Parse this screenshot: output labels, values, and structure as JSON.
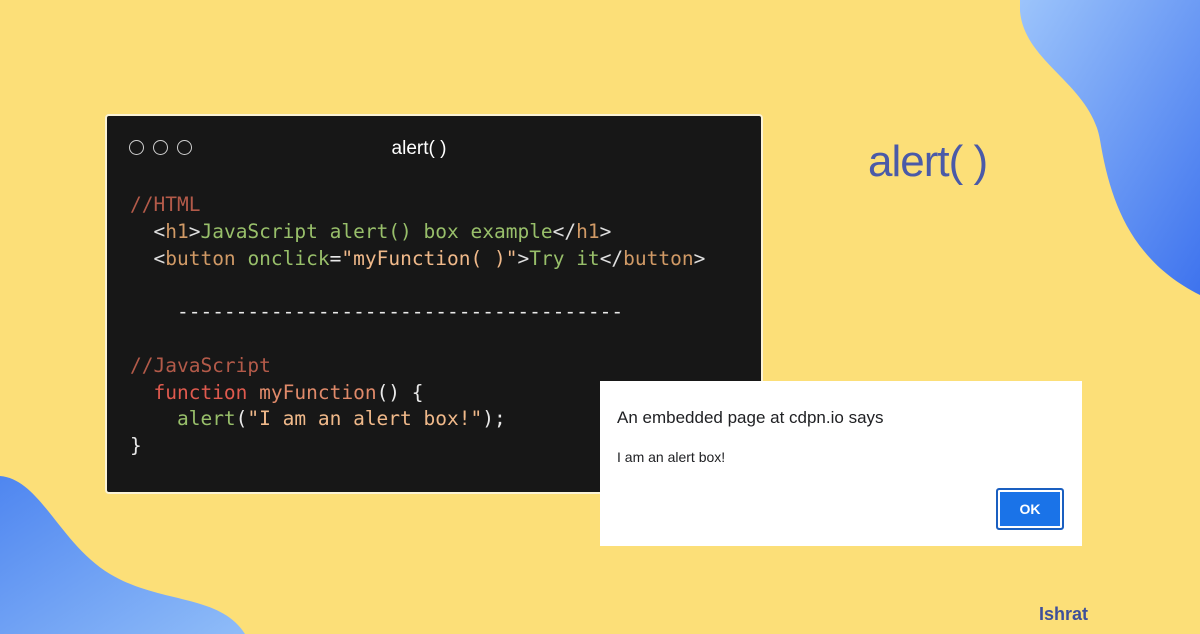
{
  "window": {
    "title": "alert( )"
  },
  "code": {
    "html_comment": "//HTML",
    "h1_open_tag": "h1",
    "h1_text": "JavaScript alert() box example",
    "h1_close_tag": "h1",
    "button_tag": "button",
    "button_attr": "onclick",
    "button_attr_value": "\"myFunction( )\"",
    "button_text": "Try it",
    "button_close_tag": "button",
    "separator": "--------------------------------------",
    "js_comment": "//JavaScript",
    "function_keyword": "function",
    "function_name": "myFunction",
    "function_open": "() {",
    "alert_call": "alert",
    "alert_arg": "\"I am an alert box!\"",
    "alert_close": ");",
    "closing_brace": "}"
  },
  "heading": {
    "text": "alert( )"
  },
  "dialog": {
    "title": "An embedded page at cdpn.io says",
    "message": "I am an alert box!",
    "ok_label": "OK"
  },
  "signature": "Ishrat",
  "colors": {
    "background": "#fcdf78",
    "code_bg": "#171717",
    "heading": "#4a5aa8",
    "ok_button": "#1a73e8",
    "blob_blue": "#5b8ef0"
  }
}
